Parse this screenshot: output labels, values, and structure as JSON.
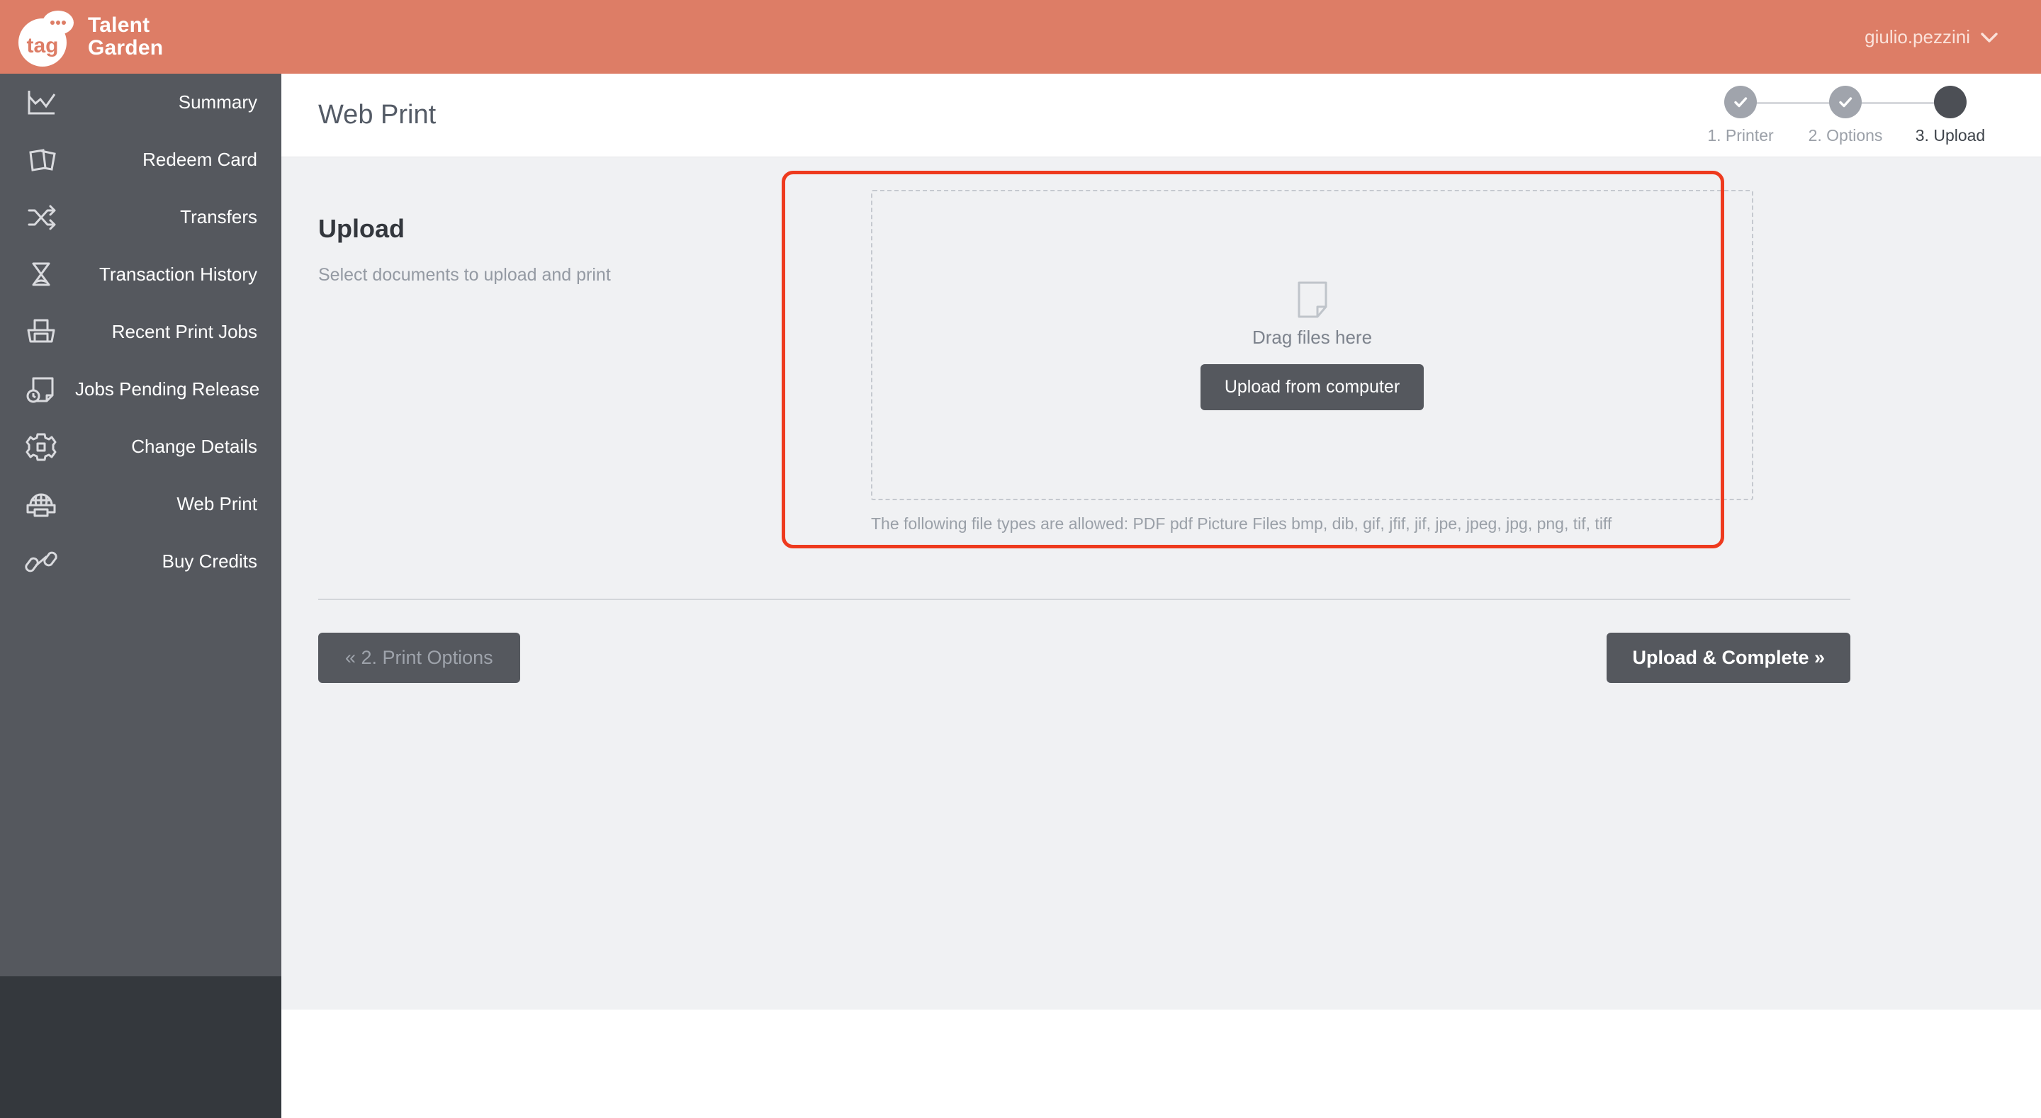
{
  "brand": {
    "logo_icon": "tag-speech-bubble-logo",
    "line1": "Talent",
    "line2": "Garden"
  },
  "header": {
    "user_name": "giulio.pezzini",
    "caret_icon": "chevron-down-icon"
  },
  "sidebar": {
    "items": [
      {
        "label": "Summary",
        "icon": "line-chart-icon"
      },
      {
        "label": "Redeem Card",
        "icon": "cards-icon"
      },
      {
        "label": "Transfers",
        "icon": "shuffle-arrows-icon"
      },
      {
        "label": "Transaction History",
        "icon": "hourglass-icon"
      },
      {
        "label": "Recent Print Jobs",
        "icon": "printer-tray-icon"
      },
      {
        "label": "Jobs Pending Release",
        "icon": "document-clock-icon"
      },
      {
        "label": "Change Details",
        "icon": "gear-icon"
      },
      {
        "label": "Web Print",
        "icon": "globe-printer-icon"
      },
      {
        "label": "Buy Credits",
        "icon": "chain-link-icon"
      }
    ]
  },
  "page": {
    "title": "Web Print",
    "steps": [
      {
        "label": "1. Printer",
        "state": "done"
      },
      {
        "label": "2. Options",
        "state": "done"
      },
      {
        "label": "3. Upload",
        "state": "current"
      }
    ]
  },
  "upload": {
    "heading": "Upload",
    "subheading": "Select documents to upload and print",
    "dropzone_icon": "file-page-icon",
    "dropzone_text": "Drag files here",
    "upload_button": "Upload from computer",
    "file_types": "The following file types are allowed: PDF pdf Picture Files bmp, dib, gif, jfif, jif, jpe, jpeg, jpg, png, tif, tiff"
  },
  "actions": {
    "back_label": "« 2. Print Options",
    "next_label": "Upload & Complete »"
  },
  "colors": {
    "brand_bar": "#dd7d66",
    "sidebar": "#55585e",
    "sidebar_footer": "#34383d",
    "content_bg": "#f0f1f3",
    "highlight": "#ee3a1e",
    "button_dark": "#55585e",
    "step_done": "#a0a4ac",
    "step_current": "#4c4f55"
  }
}
